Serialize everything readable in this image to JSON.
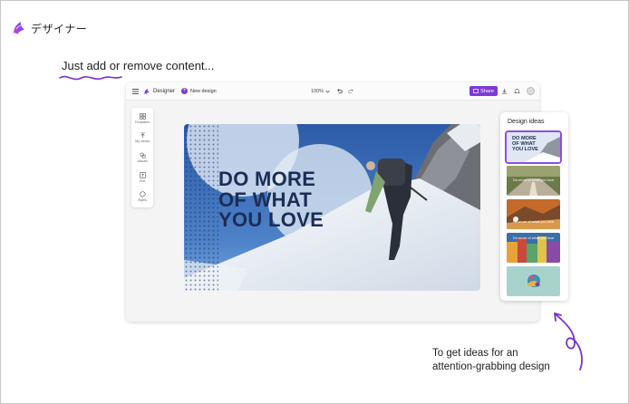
{
  "brand": {
    "label": "デザイナー"
  },
  "headline": "Just add or remove content...",
  "app": {
    "brand": "Designer",
    "new_design": "New design",
    "zoom": "100%",
    "share": "Share",
    "sidebar": [
      {
        "label": "Templates",
        "icon": "grid-icon"
      },
      {
        "label": "My media",
        "icon": "upload-icon"
      },
      {
        "label": "Visuals",
        "icon": "shapes-icon"
      },
      {
        "label": "Text",
        "icon": "text-icon"
      },
      {
        "label": "Styles",
        "icon": "palette-icon"
      }
    ],
    "canvas": {
      "lines": [
        "DO MORE",
        "OF WHAT",
        "YOU LOVE"
      ]
    },
    "ideas": {
      "title": "Design ideas",
      "thumbs": [
        {
          "lines": [
            "DO MORE",
            "OF WHAT",
            "YOU LOVE"
          ]
        },
        {
          "caption": "Do more of what you love"
        },
        {
          "caption": "Do more of what you love"
        },
        {
          "caption": "Do more of what you love"
        }
      ]
    }
  },
  "tip": {
    "line1": "To get ideas for an",
    "line2": "attention-grabbing design"
  },
  "colors": {
    "accent": "#7c3bd6",
    "title_text": "#1c2d55",
    "sky": "#2f5fae"
  }
}
